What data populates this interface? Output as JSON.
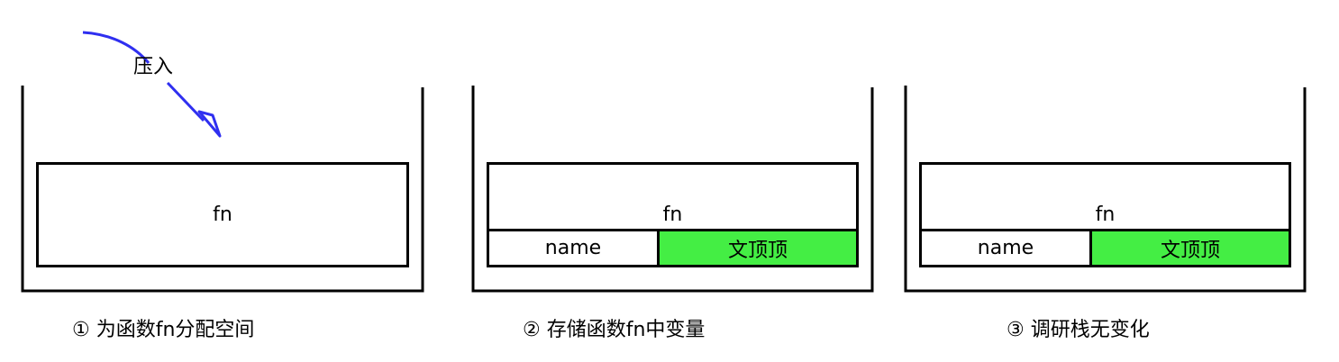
{
  "arrow": {
    "label": "压入",
    "color": "#2f2ff0"
  },
  "panels": [
    {
      "frame_label": "fn",
      "caption": "① 为函数fn分配空间"
    },
    {
      "frame_label": "fn",
      "var_name": "name",
      "var_value": "文顶顶",
      "caption": "② 存储函数fn中变量"
    },
    {
      "frame_label": "fn",
      "var_name": "name",
      "var_value": "文顶顶",
      "caption": "③ 调研栈无变化"
    }
  ],
  "colors": {
    "value_fill": "#44ee44",
    "stroke": "#000000"
  }
}
